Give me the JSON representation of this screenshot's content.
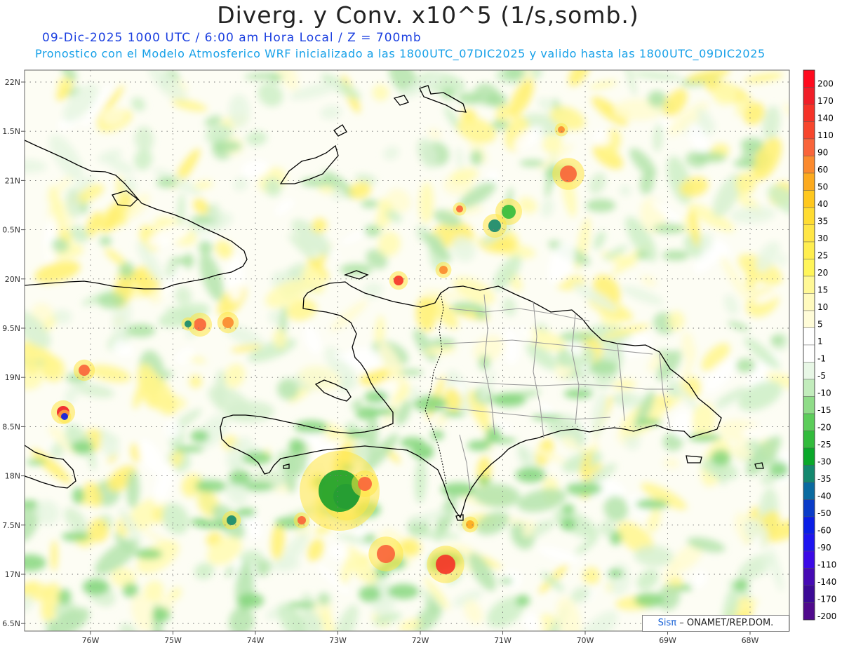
{
  "title": "Diverg. y Conv. x10^5 (1/s,somb.)",
  "subtitle_line1": "09-Dic-2025  1000 UTC / 6:00 am Hora Local / Z = 700mb",
  "subtitle_line2": "Pronostico con el Modelo Atmosferico WRF inicializado a las 1800UTC_07DIC2025 y valido hasta las  1800UTC_09DIC2025",
  "lat_labels": [
    "22N",
    "1.5N",
    "21N",
    "0.5N",
    "20N",
    "9.5N",
    "19N",
    "8.5N",
    "18N",
    "7.5N",
    "17N",
    "6.5N"
  ],
  "lon_labels": [
    "76W",
    "75W",
    "74W",
    "73W",
    "72W",
    "71W",
    "70W",
    "69W",
    "68W"
  ],
  "colorbar": {
    "labels": [
      "200",
      "170",
      "140",
      "110",
      "90",
      "60",
      "50",
      "40",
      "35",
      "30",
      "25",
      "20",
      "15",
      "10",
      "5",
      "1",
      "-1",
      "-5",
      "-10",
      "-15",
      "-20",
      "-25",
      "-30",
      "-35",
      "-40",
      "-50",
      "-60",
      "-90",
      "-110",
      "-140",
      "-170",
      "-200"
    ],
    "colors": [
      "#ff0a1e",
      "#f01e28",
      "#f53228",
      "#f7462d",
      "#f9643a",
      "#fb8a2e",
      "#fcaa1e",
      "#ffc81e",
      "#ffdc32",
      "#ffe646",
      "#ffee50",
      "#fff55a",
      "#fff896",
      "#fffabe",
      "#fffcd8",
      "#ffffff",
      "#ffffff",
      "#e8f7e6",
      "#c2ecbc",
      "#8fdc88",
      "#5ccd5a",
      "#32bb3c",
      "#0aa82a",
      "#14886e",
      "#0a6aa0",
      "#0a3cc8",
      "#0a1ee6",
      "#1e14f0",
      "#3c0ae6",
      "#460ab4",
      "#3c0a96",
      "#500a8c"
    ]
  },
  "credit": {
    "brand": "Sisπ",
    "text": "– ONAMET/REP.DOM."
  }
}
